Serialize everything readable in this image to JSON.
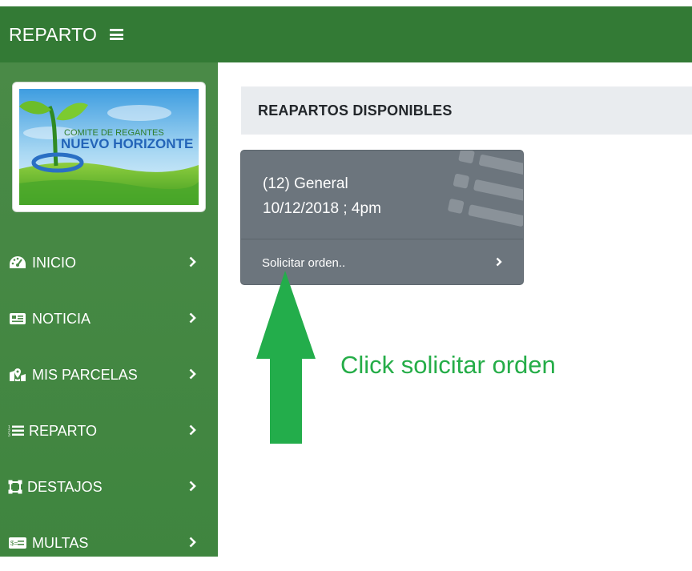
{
  "navbar": {
    "brand": "REPARTO",
    "menu_icon": "hamburger-icon"
  },
  "sidebar": {
    "logo": {
      "line1": "COMITE DE REGANTES",
      "line2": "NUEVO HORIZONTE"
    },
    "items": [
      {
        "label": "INICIO",
        "icon": "tachometer-icon"
      },
      {
        "label": "NOTICIA",
        "icon": "newspaper-icon"
      },
      {
        "label": "MIS PARCELAS",
        "icon": "map-marker-icon"
      },
      {
        "label": "REPARTO",
        "icon": "list-icon"
      },
      {
        "label": "DESTAJOS",
        "icon": "vector-square-icon"
      },
      {
        "label": "MULTAS",
        "icon": "money-bill-icon"
      }
    ]
  },
  "main": {
    "header": "REAPARTOS DISPONIBLES",
    "card": {
      "line1": "(12) General",
      "line2": "10/12/2018 ; 4pm",
      "footer_label": "Solicitar orden..",
      "bg_color": "#6c757d"
    },
    "annotation": {
      "text": "Click solicitar orden",
      "color": "#25ad48"
    }
  }
}
